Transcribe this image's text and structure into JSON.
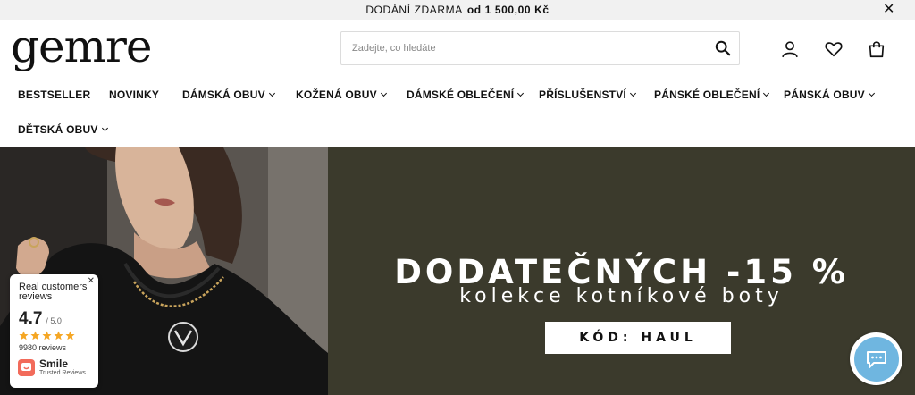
{
  "topbar": {
    "free_shipping": "DODÁNÍ ZDARMA",
    "threshold": "od 1 500,00 Kč",
    "close_icon": "close-icon"
  },
  "header": {
    "logo": "gemre",
    "search": {
      "placeholder": "Zadejte, co hledáte",
      "value": "",
      "icon": "search-icon"
    },
    "icons": [
      "user-icon",
      "heart-icon",
      "shopping-bag-icon"
    ]
  },
  "nav": {
    "items": [
      {
        "label": "BESTSELLER",
        "dropdown": false
      },
      {
        "label": "NOVINKY",
        "dropdown": false
      },
      {
        "label": "DÁMSKÁ OBUV",
        "dropdown": true
      },
      {
        "label": "KOŽENÁ OBUV",
        "dropdown": true
      },
      {
        "label": "DÁMSKÉ OBLEČENÍ",
        "dropdown": true
      },
      {
        "label": "PŘÍSLUŠENSTVÍ",
        "dropdown": true
      },
      {
        "label": "PÁNSKÉ OBLEČENÍ",
        "dropdown": true
      },
      {
        "label": "PÁNSKÁ OBUV",
        "dropdown": true
      },
      {
        "label": "DĚTSKÁ OBUV",
        "dropdown": true
      }
    ]
  },
  "hero": {
    "title": "DODATEČNÝCH -15 %",
    "subtitle": "kolekce kotníkové boty",
    "code_label": "KÓD: HAUL",
    "banner_color": "#3b3a2c"
  },
  "reviews_widget": {
    "heading": "Real customers reviews",
    "score": "4.7",
    "out_of": "/ 5.0",
    "stars": 5,
    "count": "9980 reviews",
    "brand": "Smile",
    "brand_sub": "Trusted Reviews",
    "star_color": "#f5a623"
  },
  "chat": {
    "icon": "chat-bubble-icon",
    "color": "#6fb6e0"
  }
}
